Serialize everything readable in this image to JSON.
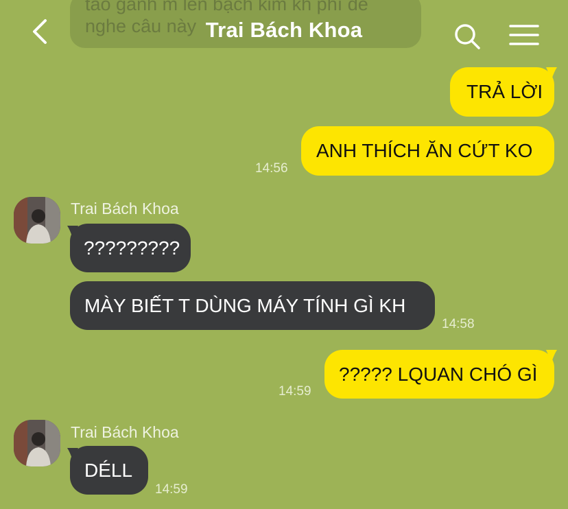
{
  "header": {
    "title": "Trai Bách Khoa",
    "back_icon": "chevron-left-icon",
    "search_icon": "search-icon",
    "menu_icon": "hamburger-menu-icon"
  },
  "previous_message": {
    "line1": "tao gánh m lên bạch kim kh phí để",
    "line2": "nghe câu này"
  },
  "messages": [
    {
      "text": "TRẢ LỜI"
    },
    {
      "text": "ANH THÍCH ĂN CỨT KO",
      "time": "14:56"
    },
    {
      "sender": "Trai Bách Khoa"
    },
    {
      "text": "?????????"
    },
    {
      "text": "MÀY BIẾT T DÙNG MÁY TÍNH GÌ KH",
      "time": "14:58"
    },
    {
      "text": "????? LQUAN CHÓ GÌ",
      "time": "14:59"
    },
    {
      "sender": "Trai Bách Khoa"
    },
    {
      "text": "DÉLL",
      "time": "14:59"
    }
  ],
  "colors": {
    "background": "#9db356",
    "outgoing_bubble": "#fde501",
    "incoming_bubble": "#393a3c"
  }
}
